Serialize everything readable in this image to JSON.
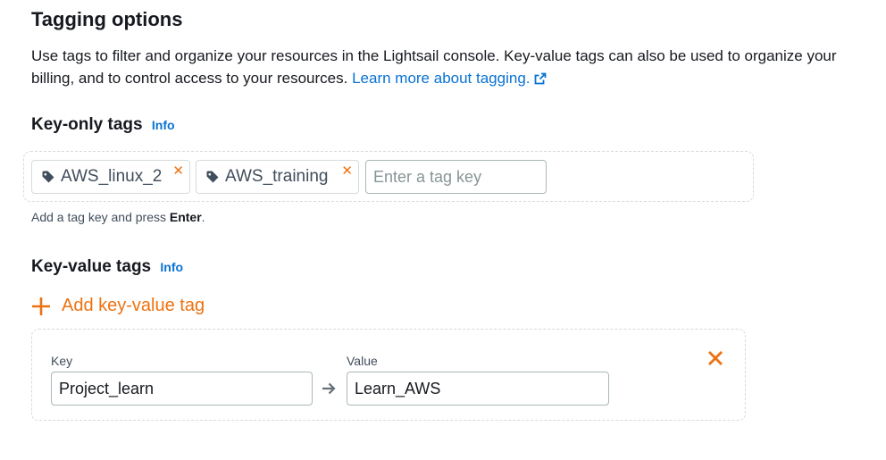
{
  "header": {
    "title": "Tagging options",
    "description": "Use tags to filter and organize your resources in the Lightsail console. Key-value tags can also be used to organize your billing, and to control access to your resources.",
    "learn_more": "Learn more about tagging."
  },
  "key_only": {
    "heading": "Key-only tags",
    "info": "Info",
    "tags": [
      {
        "label": "AWS_linux_2"
      },
      {
        "label": "AWS_training"
      }
    ],
    "input_placeholder": "Enter a tag key",
    "hint_prefix": "Add a tag key and press ",
    "hint_key": "Enter",
    "hint_suffix": "."
  },
  "key_value": {
    "heading": "Key-value tags",
    "info": "Info",
    "add_label": "Add key-value tag",
    "rows": [
      {
        "key_label": "Key",
        "key_value": "Project_learn",
        "value_label": "Value",
        "value_value": "Learn_AWS"
      }
    ]
  },
  "colors": {
    "accent_orange": "#ec7211",
    "link_blue": "#0972d3",
    "text": "#16191f",
    "muted": "#414d5c",
    "border": "#aab7b8"
  },
  "icons": {
    "external_link": "external-link-icon",
    "tag": "tag-icon",
    "remove": "close-icon",
    "add": "plus-icon",
    "arrow": "arrow-right-icon"
  }
}
